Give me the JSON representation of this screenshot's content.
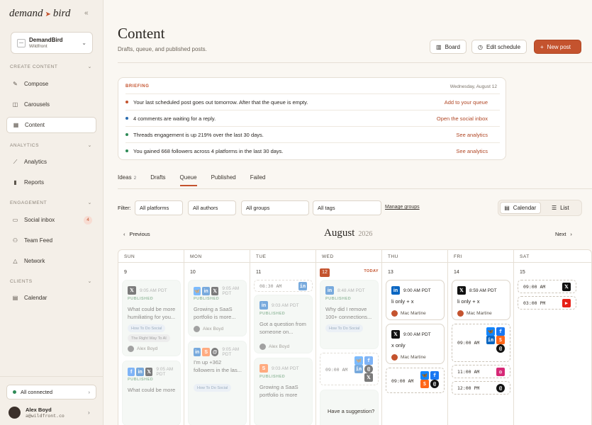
{
  "brand": {
    "name_left": "demand",
    "arrow": "➤",
    "name_right": "bird"
  },
  "workspace": {
    "name": "DemandBird",
    "sub": "Wildfront"
  },
  "sidebar": {
    "sections": [
      "CREATE CONTENT",
      "ANALYTICS",
      "ENGAGEMENT",
      "CLIENTS"
    ],
    "items": [
      {
        "label": "Compose",
        "icon": "pencil-icon"
      },
      {
        "label": "Carousels",
        "icon": "carousel-icon"
      },
      {
        "label": "Content",
        "icon": "grid-icon"
      },
      {
        "label": "Analytics",
        "icon": "trend-icon"
      },
      {
        "label": "Reports",
        "icon": "bar-chart-icon"
      },
      {
        "label": "Social inbox",
        "icon": "chat-icon",
        "badge": "4"
      },
      {
        "label": "Team Feed",
        "icon": "people-icon"
      },
      {
        "label": "Network",
        "icon": "network-icon"
      },
      {
        "label": "Calendar",
        "icon": "calendar-icon"
      }
    ],
    "connected": "All connected",
    "user": {
      "name": "Alex Boyd",
      "email": "a@wildfront.co"
    }
  },
  "header": {
    "title": "Content",
    "subtitle": "Drafts, queue, and published posts.",
    "board": "Board",
    "edit_schedule": "Edit schedule",
    "new_post": "New post"
  },
  "briefing": {
    "label": "BRIEFING",
    "date": "Wednesday, August 12",
    "rows": [
      {
        "text": "Your last scheduled post goes out tomorrow. After that the queue is empty.",
        "action": "Add to your queue",
        "color": "#c4532e"
      },
      {
        "text": "4 comments are waiting for a reply.",
        "action": "Open the social inbox",
        "color": "#2b6cb0"
      },
      {
        "text": "Threads engagement is up 219% over the last 30 days.",
        "action": "See analytics",
        "color": "#2e8b57"
      },
      {
        "text": "You gained 668 followers across 4 platforms in the last 30 days.",
        "action": "See analytics",
        "color": "#2e8b57"
      }
    ]
  },
  "tabs": [
    {
      "label": "Ideas",
      "count": "2"
    },
    {
      "label": "Drafts"
    },
    {
      "label": "Queue"
    },
    {
      "label": "Published"
    },
    {
      "label": "Failed"
    }
  ],
  "filters": {
    "label": "Filter:",
    "platforms": "All platforms",
    "authors": "All authors",
    "groups": "All groups",
    "tags": "All tags",
    "manage": "Manage groups"
  },
  "views": {
    "calendar": "Calendar",
    "list": "List"
  },
  "calendar": {
    "prev": "Previous",
    "next": "Next",
    "month": "August",
    "year": "2026",
    "today_label": "TODAY",
    "days": [
      {
        "h": "SUN",
        "n": "9"
      },
      {
        "h": "MON",
        "n": "10"
      },
      {
        "h": "TUE",
        "n": "11"
      },
      {
        "h": "WED",
        "n": "12"
      },
      {
        "h": "THU",
        "n": "13"
      },
      {
        "h": "FRI",
        "n": "14"
      },
      {
        "h": "SAT",
        "n": "15"
      }
    ],
    "published": "PUBLISHED",
    "posts": {
      "sun1": {
        "time": "9:05 AM PDT",
        "text": "What could be more humiliating for you...",
        "tag1": "How To Do Social",
        "tag2": "The Right Way To AI",
        "author": "Alex Boyd"
      },
      "sun2": {
        "time": "9:05 AM PDT",
        "text": "What could be more"
      },
      "mon1": {
        "time": "9:05 AM PDT",
        "text": "Growing a SaaS portfolio is more...",
        "author": "Alex Boyd"
      },
      "mon2": {
        "time": "9:05 AM PDT",
        "text": "I'm up +362 followers in the las...",
        "tag1": "How To Do Social"
      },
      "tue0": {
        "time": "08:30 AM"
      },
      "tue1": {
        "time": "9:03 AM PDT",
        "text": "Got a question from someone on...",
        "author": "Alex Boyd"
      },
      "tue2": {
        "time": "9:03 AM PDT",
        "text": "Growing a SaaS portfolio is more"
      },
      "wed1": {
        "time": "8:48 AM PDT",
        "text": "Why did I remove 100+ connections...",
        "tag1": "How To Do Social"
      },
      "wed_slot": {
        "time": "09:00 AM"
      },
      "thu1": {
        "time": "9:00 AM PDT",
        "text": "li only + x",
        "author": "Mac Martine"
      },
      "thu2": {
        "time": "9:00 AM PDT",
        "text": "x only",
        "author": "Mac Martine"
      },
      "thu_slot": {
        "time": "09:00 AM"
      },
      "fri1": {
        "time": "8:59 AM PDT",
        "text": "li only + x",
        "author": "Mac Martine"
      },
      "fri_slots": [
        {
          "time": "09:00 AM"
        },
        {
          "time": "11:00 AM"
        },
        {
          "time": "12:00 PM"
        }
      ],
      "sat_slots": [
        {
          "time": "09:00 AM"
        },
        {
          "time": "03:00 PM"
        }
      ]
    }
  },
  "suggestion": "Have a suggestion?"
}
